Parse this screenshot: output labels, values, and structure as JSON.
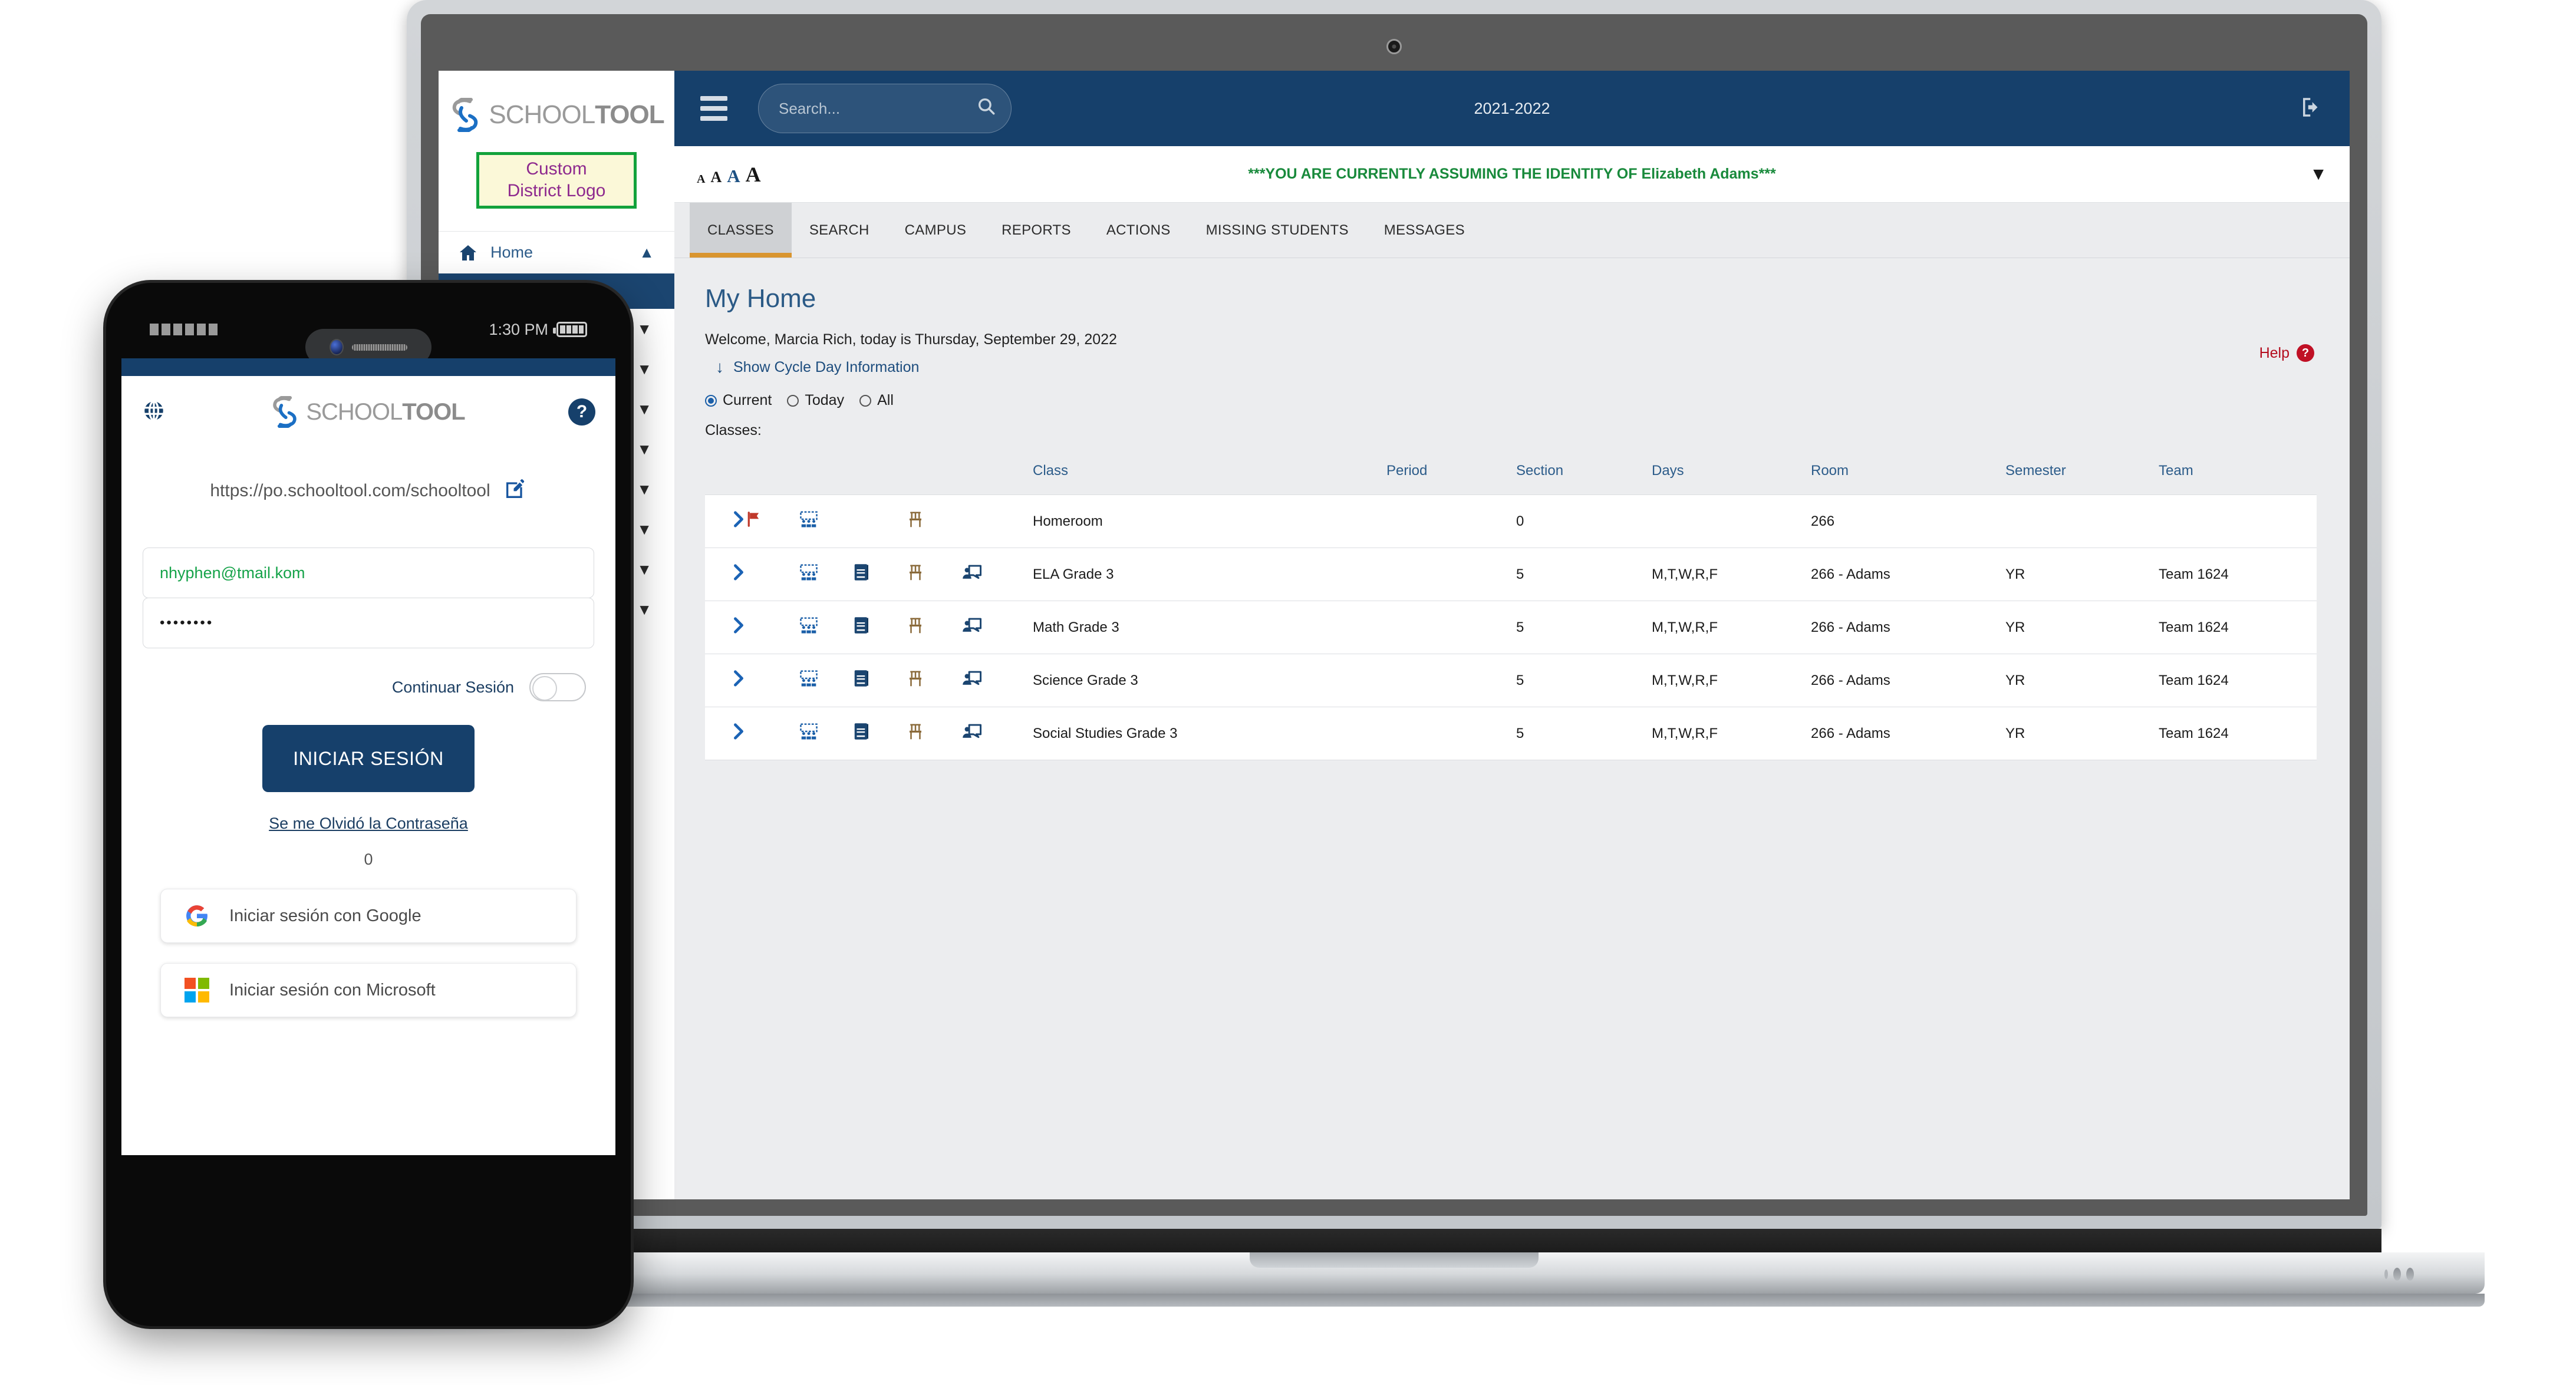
{
  "brand": {
    "name_light": "SCHOOL",
    "name_bold": "TOOL",
    "mark": "schooltool-s-logo"
  },
  "laptop": {
    "sidebar": {
      "district_logo_line1": "Custom",
      "district_logo_line2": "District Logo",
      "home_label": "Home",
      "home_icon": "home-icon",
      "home_chevron": "chevron-up-icon",
      "collapsed_rows": [
        {
          "chevron": "chevron-down-icon"
        },
        {
          "chevron": "chevron-down-icon"
        },
        {
          "chevron": "chevron-down-icon"
        },
        {
          "chevron": "chevron-down-icon"
        },
        {
          "chevron": "chevron-down-icon"
        },
        {
          "chevron": "chevron-down-icon"
        },
        {
          "chevron": "chevron-down-icon"
        },
        {
          "chevron": "chevron-down-icon"
        }
      ]
    },
    "topbar": {
      "menu_icon": "hamburger-menu-icon",
      "search_placeholder": "Search...",
      "search_value": "",
      "search_icon": "search-icon",
      "school_year": "2021-2022",
      "logout_icon": "logout-icon"
    },
    "subbar": {
      "font_sizes": [
        "A",
        "A",
        "A",
        "A"
      ],
      "active_font_index": 2,
      "identity_banner": "***YOU ARE CURRENTLY ASSUMING THE IDENTITY OF Elizabeth Adams***",
      "identity_banner_color": "#198a3c",
      "expand_chevron": "chevron-down-icon"
    },
    "tabs": [
      {
        "label": "CLASSES",
        "active": true
      },
      {
        "label": "SEARCH",
        "active": false
      },
      {
        "label": "CAMPUS",
        "active": false
      },
      {
        "label": "REPORTS",
        "active": false
      },
      {
        "label": "ACTIONS",
        "active": false
      },
      {
        "label": "MISSING STUDENTS",
        "active": false
      },
      {
        "label": "MESSAGES",
        "active": false
      }
    ],
    "page": {
      "title": "My Home",
      "welcome": "Welcome, Marcia Rich, today is Thursday, September 29, 2022",
      "cycle_day_link": "Show Cycle Day Information",
      "cycle_day_icon": "arrow-down-icon",
      "filters": [
        {
          "label": "Current",
          "selected": true
        },
        {
          "label": "Today",
          "selected": false
        },
        {
          "label": "All",
          "selected": false
        }
      ],
      "classes_label": "Classes:",
      "help_label": "Help",
      "help_icon": "question-mark-icon",
      "help_color": "#b40d1e"
    },
    "table": {
      "headers": [
        "",
        "",
        "",
        "",
        "",
        "",
        "Class",
        "Period",
        "Section",
        "Days",
        "Room",
        "Semester",
        "Team"
      ],
      "column_headers": {
        "class": "Class",
        "period": "Period",
        "section": "Section",
        "days": "Days",
        "room": "Room",
        "semester": "Semester",
        "team": "Team"
      },
      "rows": [
        {
          "expand_icon": "chevron-right-icon",
          "flag_icon": "red-flag-icon",
          "has_flag": true,
          "attendance_icon": "attendance-icon",
          "gradebook_icon": "gradebook-icon",
          "has_gradebook": false,
          "seating_icon": "seating-chart-icon",
          "conference_icon": "conference-icon",
          "has_conference": false,
          "class": "Homeroom",
          "period": "",
          "section": "0",
          "days": "",
          "room": "266",
          "semester": "",
          "team": ""
        },
        {
          "expand_icon": "chevron-right-icon",
          "flag_icon": "red-flag-icon",
          "has_flag": false,
          "attendance_icon": "attendance-icon",
          "gradebook_icon": "gradebook-icon",
          "has_gradebook": true,
          "seating_icon": "seating-chart-icon",
          "conference_icon": "conference-icon",
          "has_conference": true,
          "class": "ELA Grade 3",
          "period": "",
          "section": "5",
          "days": "M,T,W,R,F",
          "room": "266 - Adams",
          "semester": "YR",
          "team": "Team 1624"
        },
        {
          "expand_icon": "chevron-right-icon",
          "flag_icon": "red-flag-icon",
          "has_flag": false,
          "attendance_icon": "attendance-icon",
          "gradebook_icon": "gradebook-icon",
          "has_gradebook": true,
          "seating_icon": "seating-chart-icon",
          "conference_icon": "conference-icon",
          "has_conference": true,
          "class": "Math Grade 3",
          "period": "",
          "section": "5",
          "days": "M,T,W,R,F",
          "room": "266 - Adams",
          "semester": "YR",
          "team": "Team 1624"
        },
        {
          "expand_icon": "chevron-right-icon",
          "flag_icon": "red-flag-icon",
          "has_flag": false,
          "attendance_icon": "attendance-icon",
          "gradebook_icon": "gradebook-icon",
          "has_gradebook": true,
          "seating_icon": "seating-chart-icon",
          "conference_icon": "conference-icon",
          "has_conference": true,
          "class": "Science Grade 3",
          "period": "",
          "section": "5",
          "days": "M,T,W,R,F",
          "room": "266 - Adams",
          "semester": "YR",
          "team": "Team 1624"
        },
        {
          "expand_icon": "chevron-right-icon",
          "flag_icon": "red-flag-icon",
          "has_flag": false,
          "attendance_icon": "attendance-icon",
          "gradebook_icon": "gradebook-icon",
          "has_gradebook": true,
          "seating_icon": "seating-chart-icon",
          "conference_icon": "conference-icon",
          "has_conference": true,
          "class": "Social Studies Grade 3",
          "period": "",
          "section": "5",
          "days": "M,T,W,R,F",
          "room": "266 - Adams",
          "semester": "YR",
          "team": "Team 1624"
        }
      ]
    }
  },
  "phone": {
    "status": {
      "time": "1:30 PM",
      "signal_icon": "signal-bars-icon",
      "battery_icon": "battery-full-icon"
    },
    "globe_icon": "globe-icon",
    "help_icon": "question-mark-icon",
    "url": "https://po.schooltool.com/schooltool",
    "edit_icon": "edit-pencil-icon",
    "email_value": "nhyphen@tmail.kom",
    "email_color": "#16a34a",
    "password_value": "••••••••",
    "continue_label": "Continuar Sesión",
    "continue_toggle_on": false,
    "login_button": "INICIAR SESIÓN",
    "forgot_password": "Se me Olvidó la Contraseña",
    "counter": "0",
    "google_button": "Iniciar sesión con Google",
    "google_icon": "google-g-icon",
    "microsoft_button": "Iniciar sesión con Microsoft",
    "microsoft_icon": "microsoft-squares-icon"
  },
  "colors": {
    "navy": "#16406b",
    "orange_tab": "#d9952f",
    "green_banner": "#198a3c",
    "red_help": "#b40d1e",
    "brand_gray": "#8c8c8c",
    "brand_blue": "#1b6fc4"
  }
}
